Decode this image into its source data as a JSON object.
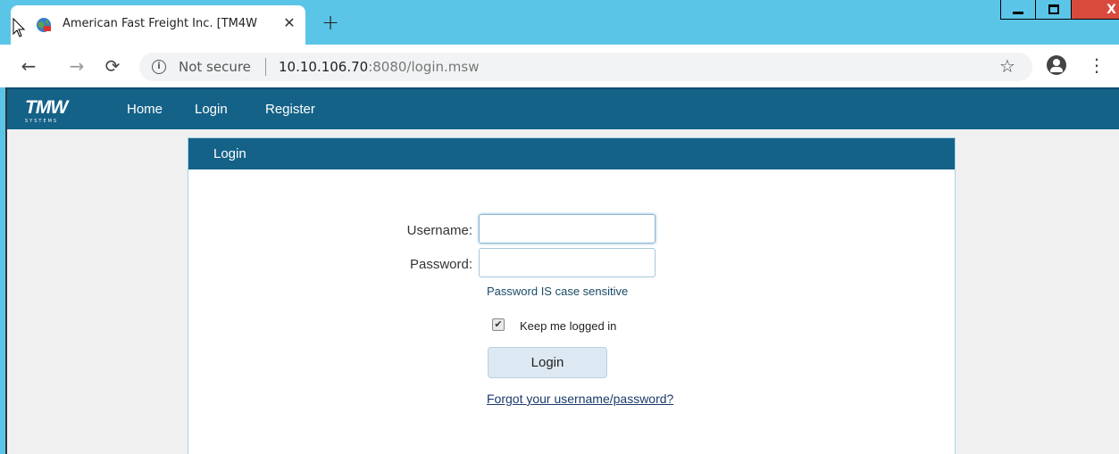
{
  "browser": {
    "tab_title": "American Fast Freight Inc. [TM4W",
    "tab_close": "✕",
    "new_tab": "+",
    "not_secure": "Not secure",
    "url_host": "10.10.106.70",
    "url_path": ":8080/login.msw",
    "icons": [
      "back-arrow-icon",
      "forward-arrow-icon",
      "reload-icon",
      "info-icon",
      "star-icon",
      "account-icon",
      "menu-icon"
    ]
  },
  "window_controls": {
    "minimize": "▁",
    "maximize": "▢",
    "close": "X"
  },
  "site": {
    "logo": "TMW",
    "logo_sub": "SYSTEMS",
    "nav": [
      "Home",
      "Login",
      "Register"
    ]
  },
  "login": {
    "panel_title": "Login",
    "username_label": "Username:",
    "password_label": "Password:",
    "username_value": "",
    "password_value": "",
    "hint": "Password IS case sensitive",
    "keep_logged_in_label": "Keep me logged in",
    "keep_logged_in_checked": true,
    "login_button": "Login",
    "forgot_link": "Forgot your username/password?"
  },
  "colors": {
    "tabstrip": "#5bc5e8",
    "site_header": "#156288",
    "panel_border": "#a7d3ea"
  }
}
